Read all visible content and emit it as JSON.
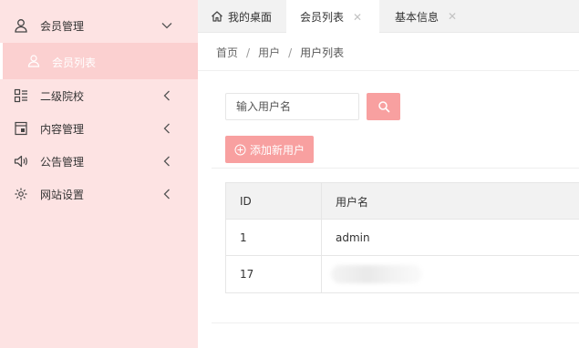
{
  "sidebar": {
    "groups": [
      {
        "label": "会员管理",
        "icon": "user-icon",
        "expanded": true
      },
      {
        "label": "二级院校",
        "icon": "grid-icon"
      },
      {
        "label": "内容管理",
        "icon": "document-icon"
      },
      {
        "label": "公告管理",
        "icon": "speaker-icon"
      },
      {
        "label": "网站设置",
        "icon": "gear-icon"
      }
    ],
    "sub_item": {
      "label": "会员列表",
      "icon": "user-icon"
    }
  },
  "tabs": [
    {
      "label": "我的桌面",
      "icon": "home-icon"
    },
    {
      "label": "会员列表",
      "close": "✕",
      "active": true
    },
    {
      "label": "基本信息",
      "close": "✕"
    }
  ],
  "breadcrumb": {
    "items": [
      "首页",
      "用户",
      "用户列表"
    ],
    "separator": "/"
  },
  "search": {
    "placeholder": "输入用户名"
  },
  "actions": {
    "add_label": "添加新用户"
  },
  "table": {
    "headers": [
      "ID",
      "用户名"
    ],
    "rows": [
      {
        "id": "1",
        "username": "admin"
      },
      {
        "id": "17",
        "username": ""
      }
    ]
  },
  "colors": {
    "accent": "#f8a0a0",
    "sidebar_bg": "#fde3e3",
    "sidebar_active": "#fbd0d0"
  }
}
